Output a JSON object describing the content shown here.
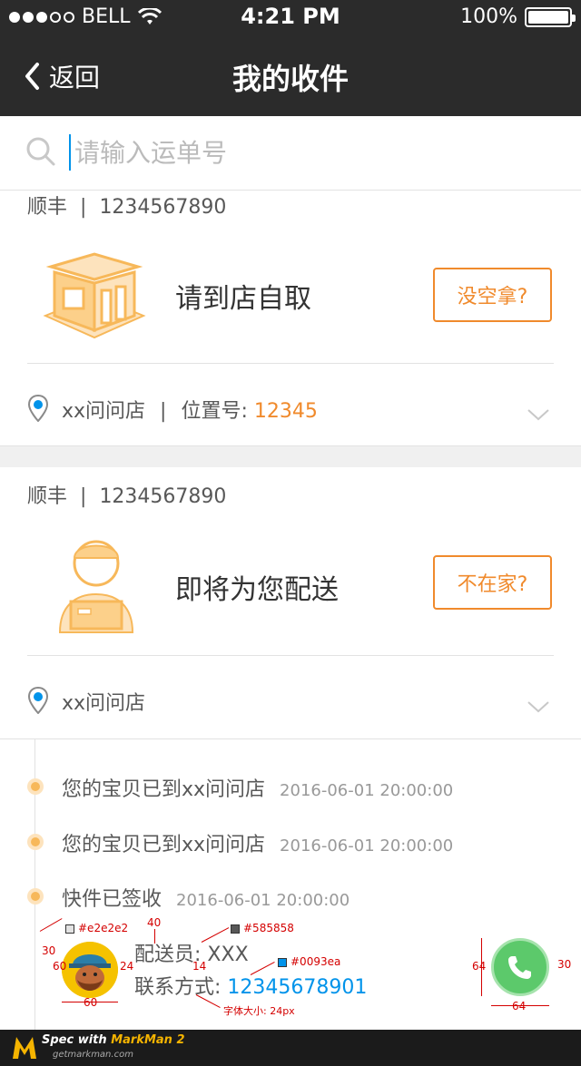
{
  "status_bar": {
    "carrier": "BELL",
    "time": "4:21 PM",
    "battery": "100%",
    "battery_level": 1.0
  },
  "nav": {
    "back_label": "返回",
    "title": "我的收件"
  },
  "search": {
    "placeholder": "请输入运单号",
    "value": ""
  },
  "cards": [
    {
      "courier": "顺丰",
      "tracking": "1234567890",
      "status": "请到店自取",
      "action": "没空拿?",
      "store": "xx问问店",
      "position_label": "位置号:",
      "position_value": "12345"
    },
    {
      "courier": "顺丰",
      "tracking": "1234567890",
      "status": "即将为您配送",
      "action": "不在家?",
      "store": "xx问问店"
    }
  ],
  "separator": "|",
  "timeline": [
    {
      "text": "您的宝贝已到xx问问店",
      "time": "2016-06-01 20:00:00"
    },
    {
      "text": "您的宝贝已到xx问问店",
      "time": "2016-06-01 20:00:00"
    },
    {
      "text": "快件已签收",
      "time": "2016-06-01 20:00:00"
    }
  ],
  "courier_info": {
    "name_label": "配送员:",
    "name": "XXX",
    "phone_label": "联系方式:",
    "phone": "12345678901"
  },
  "annotations": {
    "color_line": "#e2e2e2",
    "color_text": "#585858",
    "color_link": "#0093ea",
    "m40": "40",
    "m30a": "30",
    "m60a": "60",
    "m24": "24",
    "m14": "14",
    "m60b": "60",
    "m64a": "64",
    "m30b": "30",
    "m64b": "64",
    "font_size_note": "字体大小: 24px"
  },
  "footer": {
    "brand_prefix": "Spec with ",
    "brand": "MarkMan 2",
    "url": "getmarkman.com"
  },
  "colors": {
    "accent": "#f08a2c",
    "link": "#0093ea",
    "call": "#5cc96b",
    "nav_bg": "#2b2b2b"
  }
}
